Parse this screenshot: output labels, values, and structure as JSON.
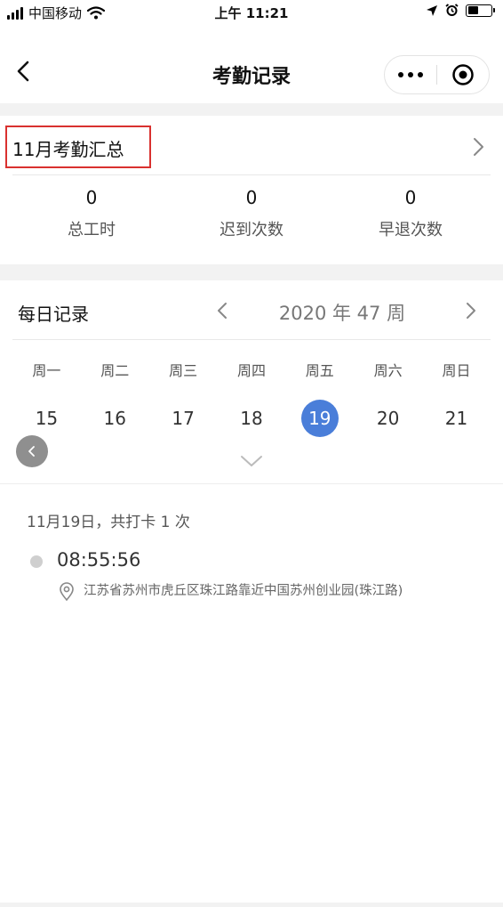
{
  "status_bar": {
    "carrier": "中国移动",
    "time": "上午 11:21",
    "icons": [
      "signal-icon",
      "wifi-icon",
      "location-arrow-icon",
      "alarm-icon",
      "battery-icon"
    ]
  },
  "nav": {
    "title": "考勤记录",
    "back_icon": "chevron-left-icon",
    "capsule_icons": [
      "more-dots-icon",
      "close-target-icon"
    ]
  },
  "summary": {
    "title": "11月考勤汇总",
    "stats": [
      {
        "value": "0",
        "label": "总工时"
      },
      {
        "value": "0",
        "label": "迟到次数"
      },
      {
        "value": "0",
        "label": "早退次数"
      }
    ]
  },
  "daily": {
    "title": "每日记录",
    "week_label": "2020 年 47 周",
    "weekdays": [
      "周一",
      "周二",
      "周三",
      "周四",
      "周五",
      "周六",
      "周日"
    ],
    "dates": [
      "15",
      "16",
      "17",
      "18",
      "19",
      "20",
      "21"
    ],
    "selected_date": "19"
  },
  "record": {
    "summary": "11月19日，共打卡 1 次",
    "entries": [
      {
        "time": "08:55:56",
        "location": "江苏省苏州市虎丘区珠江路靠近中国苏州创业园(珠江路)"
      }
    ]
  },
  "colors": {
    "accent": "#4a7ed9",
    "highlight_box": "#d9312f",
    "section_band": "#f2f2f2"
  }
}
